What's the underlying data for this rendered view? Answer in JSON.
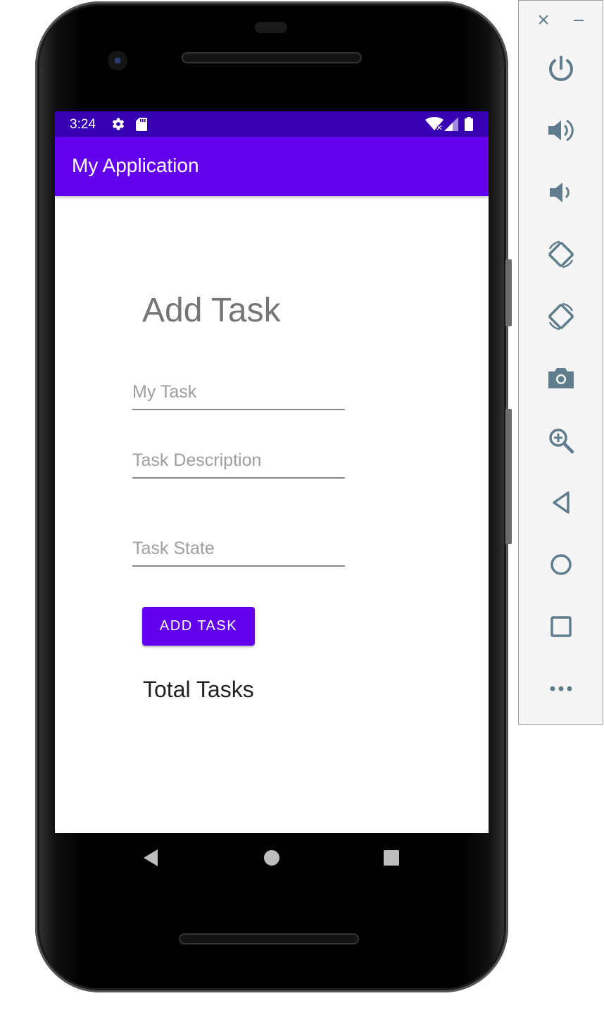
{
  "status_bar": {
    "time": "3:24",
    "icons": [
      "settings-icon",
      "sd-card-icon",
      "wifi-icon",
      "signal-icon",
      "battery-icon"
    ]
  },
  "app_bar": {
    "title": "My Application"
  },
  "form": {
    "heading": "Add Task",
    "task_name": {
      "placeholder": "My Task",
      "value": ""
    },
    "task_description": {
      "placeholder": "Task Description",
      "value": ""
    },
    "task_state": {
      "placeholder": "Task State",
      "value": ""
    },
    "add_button_label": "ADD TASK",
    "total_label": "Total Tasks"
  },
  "nav_bar": {
    "icons": [
      "back-icon",
      "home-icon",
      "recents-icon"
    ]
  },
  "emulator_toolbar": {
    "icons": [
      "close-icon",
      "minimize-icon",
      "power-icon",
      "volume-up-icon",
      "volume-down-icon",
      "rotate-left-icon",
      "rotate-right-icon",
      "camera-icon",
      "zoom-icon",
      "back-icon",
      "home-icon",
      "overview-icon",
      "more-icon"
    ]
  },
  "colors": {
    "primary": "#6200ee",
    "primary_dark": "#3700b3",
    "toolbar_icon": "#5f7d8c"
  }
}
